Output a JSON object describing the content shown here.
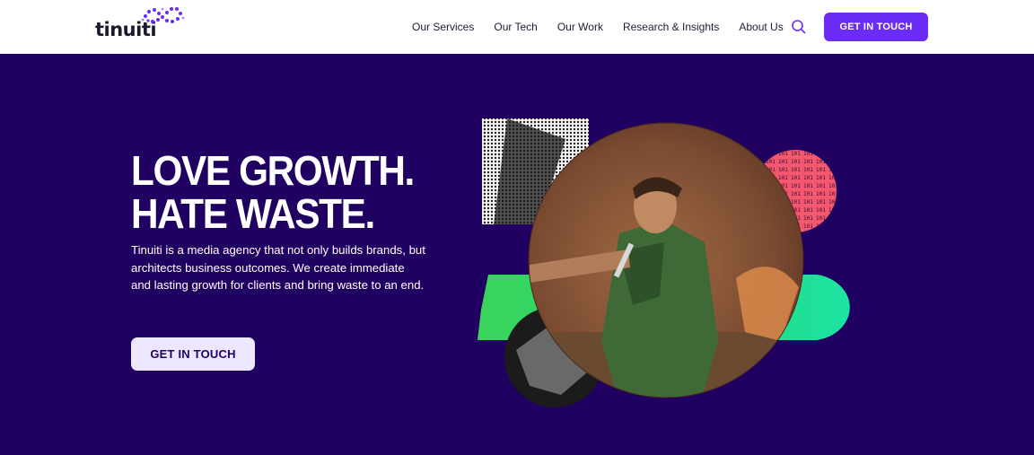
{
  "brand": {
    "logo_text": "tinuiti",
    "accent": "#6b2cf5",
    "hero_bg": "#200060"
  },
  "nav": {
    "items": [
      {
        "label": "Our Services"
      },
      {
        "label": "Our Tech"
      },
      {
        "label": "Our Work"
      },
      {
        "label": "Research & Insights"
      },
      {
        "label": "About Us"
      }
    ],
    "search_icon": "search-icon",
    "cta_label": "GET IN TOUCH"
  },
  "hero": {
    "headline_line1": "LOVE GROWTH.",
    "headline_line2": "HATE WASTE.",
    "body": "Tinuiti is a media agency that not only builds brands, but architects business outcomes. We create immediate and lasting growth for clients and bring waste to an end.",
    "cta_label": "GET IN TOUCH"
  },
  "collage": {
    "shapes": [
      "halftone-photo-square",
      "pink-binary-circle",
      "green-gradient-pill",
      "grayscale-photo-circle",
      "video-circle-singer"
    ]
  }
}
